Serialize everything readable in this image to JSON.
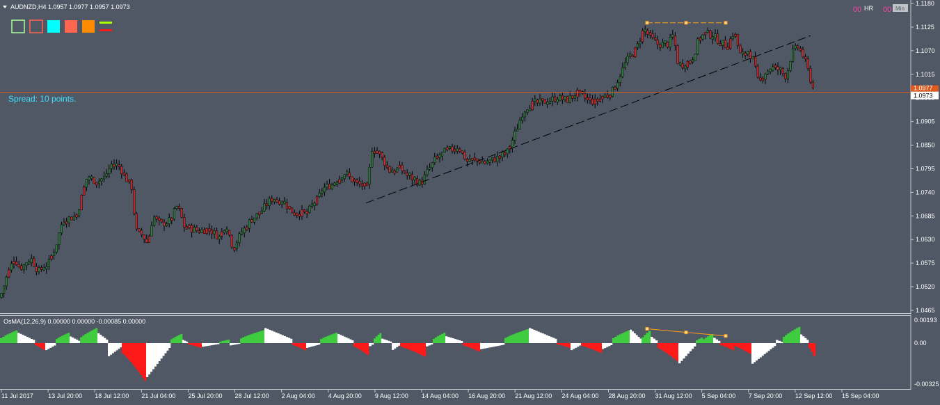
{
  "symbol_line": "AUDNZD,H4  1.0957 1.0977 1.0957 1.0973",
  "spread_text": "Spread: 10 points.",
  "hr_label": "HR",
  "hr_counter": "00",
  "min_label": "Min",
  "min_counter": "00",
  "osma_label": "OsMA(12,26,9) 0.00000 0.00000 -0.00085 0.00000",
  "current_price_label": "1.0973",
  "current_price_label_upper": "1.0977",
  "colors": {
    "background": "#4f5864",
    "bull_candle": "#2f7d3a",
    "bear_candle": "#cc2c2c",
    "grid_axis": "#c8ccd0",
    "price_line": "#e05a1e",
    "osma_up_green": "#3fcc3f",
    "osma_down_red": "#ff1a1a",
    "osma_white": "#ffffff",
    "spread_text": "#40e0ff",
    "divergence_line": "#ff9f1a",
    "trend_line": "#000000"
  },
  "toolbar_swatches": [
    {
      "name": "green-outline-box",
      "color": "#aaff99",
      "style": "outline"
    },
    {
      "name": "red-outline-box",
      "color": "#ff6650",
      "style": "outline"
    },
    {
      "name": "cyan-box",
      "color": "#00ffff",
      "style": "filled"
    },
    {
      "name": "salmon-box",
      "color": "#ff6650",
      "style": "filled"
    },
    {
      "name": "orange-box",
      "color": "#ff8c00",
      "style": "filled"
    },
    {
      "name": "lines-icon",
      "color": "#aaff00",
      "style": "lines"
    }
  ],
  "chart_data": [
    {
      "type": "candlestick",
      "title": "AUDNZD,H4",
      "ylim": [
        1.0465,
        1.118
      ],
      "y_ticks": [
        "1.1180",
        "1.1125",
        "1.1070",
        "1.1015",
        "1.0960",
        "1.0905",
        "1.0850",
        "1.0795",
        "1.0740",
        "1.0685",
        "1.0630",
        "1.0575",
        "1.0520",
        "1.0465"
      ],
      "x_ticks": [
        "11 Jul 2017",
        "13 Jul 20:00",
        "18 Jul 12:00",
        "21 Jul 04:00",
        "25 Jul 20:00",
        "28 Jul 12:00",
        "2 Aug 04:00",
        "4 Aug 20:00",
        "9 Aug 12:00",
        "14 Aug 04:00",
        "16 Aug 20:00",
        "21 Aug 12:00",
        "24 Aug 04:00",
        "28 Aug 20:00",
        "31 Aug 12:00",
        "5 Sep 04:00",
        "7 Sep 20:00",
        "12 Sep 12:00",
        "15 Sep 04:00"
      ],
      "current_price": 1.0973,
      "close_path": [
        [
          0,
          1.0495
        ],
        [
          10,
          1.0545
        ],
        [
          20,
          1.0585
        ],
        [
          30,
          1.0565
        ],
        [
          45,
          1.0585
        ],
        [
          55,
          1.0555
        ],
        [
          70,
          1.0575
        ],
        [
          80,
          1.0615
        ],
        [
          90,
          1.0675
        ],
        [
          110,
          1.0685
        ],
        [
          125,
          1.0775
        ],
        [
          140,
          1.0765
        ],
        [
          150,
          1.0775
        ],
        [
          160,
          1.0805
        ],
        [
          172,
          1.08
        ],
        [
          180,
          1.0775
        ],
        [
          190,
          1.075
        ],
        [
          195,
          1.065
        ],
        [
          205,
          1.064
        ],
        [
          212,
          1.062
        ],
        [
          220,
          1.0685
        ],
        [
          232,
          1.0665
        ],
        [
          245,
          1.0675
        ],
        [
          255,
          1.071
        ],
        [
          265,
          1.066
        ],
        [
          285,
          1.065
        ],
        [
          300,
          1.0655
        ],
        [
          315,
          1.0635
        ],
        [
          325,
          1.0665
        ],
        [
          335,
          1.061
        ],
        [
          345,
          1.064
        ],
        [
          360,
          1.0675
        ],
        [
          375,
          1.0695
        ],
        [
          390,
          1.0725
        ],
        [
          405,
          1.072
        ],
        [
          420,
          1.0695
        ],
        [
          440,
          1.069
        ],
        [
          455,
          1.072
        ],
        [
          465,
          1.075
        ],
        [
          480,
          1.076
        ],
        [
          495,
          1.0785
        ],
        [
          505,
          1.077
        ],
        [
          515,
          1.076
        ],
        [
          528,
          1.075
        ],
        [
          535,
          1.0845
        ],
        [
          545,
          1.083
        ],
        [
          560,
          1.079
        ],
        [
          575,
          1.0795
        ],
        [
          590,
          1.0775
        ],
        [
          605,
          1.076
        ],
        [
          615,
          1.079
        ],
        [
          625,
          1.0815
        ],
        [
          640,
          1.0835
        ],
        [
          660,
          1.0845
        ],
        [
          670,
          1.0815
        ],
        [
          685,
          1.0815
        ],
        [
          700,
          1.081
        ],
        [
          715,
          1.082
        ],
        [
          730,
          1.0835
        ],
        [
          742,
          1.0885
        ],
        [
          752,
          1.093
        ],
        [
          765,
          1.0945
        ],
        [
          780,
          1.095
        ],
        [
          800,
          1.096
        ],
        [
          815,
          1.0955
        ],
        [
          830,
          1.097
        ],
        [
          845,
          1.0955
        ],
        [
          855,
          1.095
        ],
        [
          870,
          1.0965
        ],
        [
          880,
          1.0975
        ],
        [
          890,
          1.101
        ],
        [
          900,
          1.1045
        ],
        [
          915,
          1.1075
        ],
        [
          925,
          1.112
        ],
        [
          935,
          1.11
        ],
        [
          945,
          1.1085
        ],
        [
          960,
          1.1085
        ],
        [
          968,
          1.1105
        ],
        [
          975,
          1.1035
        ],
        [
          985,
          1.104
        ],
        [
          995,
          1.105
        ],
        [
          1005,
          1.11
        ],
        [
          1015,
          1.111
        ],
        [
          1025,
          1.1105
        ],
        [
          1035,
          1.109
        ],
        [
          1045,
          1.108
        ],
        [
          1055,
          1.1115
        ],
        [
          1065,
          1.1055
        ],
        [
          1075,
          1.107
        ],
        [
          1082,
          1.105
        ],
        [
          1090,
          1.0995
        ],
        [
          1100,
          1.102
        ],
        [
          1110,
          1.103
        ],
        [
          1120,
          1.1025
        ],
        [
          1130,
          1.101
        ],
        [
          1138,
          1.1065
        ],
        [
          1148,
          1.108
        ],
        [
          1155,
          1.1055
        ],
        [
          1162,
          1.102
        ],
        [
          1170,
          1.0973
        ]
      ],
      "bear_segments": [
        [
          180,
          215
        ],
        [
          260,
          275
        ],
        [
          430,
          445
        ],
        [
          505,
          530
        ],
        [
          540,
          560
        ],
        [
          660,
          680
        ],
        [
          840,
          860
        ],
        [
          930,
          945
        ],
        [
          970,
          990
        ],
        [
          1050,
          1060
        ],
        [
          1080,
          1095
        ],
        [
          1150,
          1172
        ]
      ]
    },
    {
      "type": "histogram",
      "title": "OsMA(12,26,9)",
      "ylim": [
        -0.00325,
        0.00193
      ],
      "y_ticks": [
        "0.00193",
        "0.00",
        "-0.00325"
      ],
      "segments": [
        {
          "x0": 0,
          "x1": 25,
          "peak": 0.0011,
          "color": "green"
        },
        {
          "x0": 25,
          "x1": 50,
          "peak": 0.0009,
          "color": "white"
        },
        {
          "x0": 50,
          "x1": 65,
          "peak": -0.0006,
          "color": "red"
        },
        {
          "x0": 65,
          "x1": 80,
          "peak": -0.0006,
          "color": "white"
        },
        {
          "x0": 80,
          "x1": 100,
          "peak": 0.0009,
          "color": "green"
        },
        {
          "x0": 100,
          "x1": 115,
          "peak": 0.0006,
          "color": "white"
        },
        {
          "x0": 115,
          "x1": 140,
          "peak": 0.0013,
          "color": "green"
        },
        {
          "x0": 140,
          "x1": 155,
          "peak": 0.0009,
          "color": "white"
        },
        {
          "x0": 155,
          "x1": 175,
          "peak": -0.0011,
          "color": "white"
        },
        {
          "x0": 175,
          "x1": 210,
          "peak": -0.0031,
          "color": "red"
        },
        {
          "x0": 210,
          "x1": 245,
          "peak": -0.0028,
          "color": "white"
        },
        {
          "x0": 245,
          "x1": 262,
          "peak": 0.0008,
          "color": "green"
        },
        {
          "x0": 262,
          "x1": 270,
          "peak": 0.0003,
          "color": "white"
        },
        {
          "x0": 270,
          "x1": 290,
          "peak": -0.0004,
          "color": "red"
        },
        {
          "x0": 290,
          "x1": 315,
          "peak": -0.0003,
          "color": "white"
        },
        {
          "x0": 315,
          "x1": 330,
          "peak": 0.0003,
          "color": "green"
        },
        {
          "x0": 330,
          "x1": 345,
          "peak": -0.0002,
          "color": "white"
        },
        {
          "x0": 345,
          "x1": 380,
          "peak": 0.0011,
          "color": "green"
        },
        {
          "x0": 380,
          "x1": 420,
          "peak": 0.0013,
          "color": "white"
        },
        {
          "x0": 420,
          "x1": 440,
          "peak": -0.0006,
          "color": "red"
        },
        {
          "x0": 440,
          "x1": 460,
          "peak": -0.0004,
          "color": "white"
        },
        {
          "x0": 460,
          "x1": 485,
          "peak": 0.0009,
          "color": "green"
        },
        {
          "x0": 485,
          "x1": 508,
          "peak": 0.0008,
          "color": "white"
        },
        {
          "x0": 508,
          "x1": 530,
          "peak": -0.001,
          "color": "red"
        },
        {
          "x0": 530,
          "x1": 537,
          "peak": -0.0003,
          "color": "white"
        },
        {
          "x0": 537,
          "x1": 548,
          "peak": 0.0009,
          "color": "green"
        },
        {
          "x0": 548,
          "x1": 563,
          "peak": 0.0004,
          "color": "white"
        },
        {
          "x0": 563,
          "x1": 575,
          "peak": -0.0006,
          "color": "white"
        },
        {
          "x0": 575,
          "x1": 612,
          "peak": -0.0011,
          "color": "red"
        },
        {
          "x0": 612,
          "x1": 622,
          "peak": -0.0003,
          "color": "white"
        },
        {
          "x0": 622,
          "x1": 640,
          "peak": 0.0009,
          "color": "green"
        },
        {
          "x0": 640,
          "x1": 665,
          "peak": 0.0006,
          "color": "white"
        },
        {
          "x0": 665,
          "x1": 690,
          "peak": -0.0007,
          "color": "red"
        },
        {
          "x0": 690,
          "x1": 725,
          "peak": -0.0005,
          "color": "white"
        },
        {
          "x0": 725,
          "x1": 760,
          "peak": 0.0012,
          "color": "green"
        },
        {
          "x0": 760,
          "x1": 800,
          "peak": 0.0013,
          "color": "white"
        },
        {
          "x0": 800,
          "x1": 820,
          "peak": -0.0004,
          "color": "red"
        },
        {
          "x0": 820,
          "x1": 835,
          "peak": -0.0006,
          "color": "white"
        },
        {
          "x0": 835,
          "x1": 865,
          "peak": -0.0008,
          "color": "red"
        },
        {
          "x0": 865,
          "x1": 880,
          "peak": -0.0005,
          "color": "white"
        },
        {
          "x0": 880,
          "x1": 905,
          "peak": 0.0011,
          "color": "green"
        },
        {
          "x0": 905,
          "x1": 922,
          "peak": 0.0012,
          "color": "white"
        },
        {
          "x0": 922,
          "x1": 935,
          "peak": 0.0011,
          "color": "green"
        },
        {
          "x0": 935,
          "x1": 945,
          "peak": 0.0006,
          "color": "white"
        },
        {
          "x0": 945,
          "x1": 975,
          "peak": -0.0015,
          "color": "red"
        },
        {
          "x0": 975,
          "x1": 1000,
          "peak": -0.0017,
          "color": "white"
        },
        {
          "x0": 1000,
          "x1": 1010,
          "peak": 0.0005,
          "color": "green"
        },
        {
          "x0": 1010,
          "x1": 1025,
          "peak": 0.0008,
          "color": "green"
        },
        {
          "x0": 1025,
          "x1": 1035,
          "peak": 0.0005,
          "color": "white"
        },
        {
          "x0": 1035,
          "x1": 1055,
          "peak": -0.0006,
          "color": "red"
        },
        {
          "x0": 1055,
          "x1": 1080,
          "peak": -0.0009,
          "color": "red"
        },
        {
          "x0": 1080,
          "x1": 1115,
          "peak": -0.0017,
          "color": "white"
        },
        {
          "x0": 1115,
          "x1": 1125,
          "peak": 0.0003,
          "color": "white"
        },
        {
          "x0": 1125,
          "x1": 1150,
          "peak": 0.0014,
          "color": "green"
        },
        {
          "x0": 1150,
          "x1": 1162,
          "peak": 0.0008,
          "color": "white"
        },
        {
          "x0": 1162,
          "x1": 1172,
          "peak": -0.0012,
          "color": "red"
        }
      ]
    }
  ],
  "drawings": {
    "trend_line": {
      "from": [
        526,
        1.0715
      ],
      "to": [
        1165,
        1.1105
      ]
    },
    "price_divergence": [
      [
        930,
        1.1135
      ],
      [
        986,
        1.1135
      ],
      [
        1043,
        1.1135
      ]
    ],
    "osma_divergence": [
      [
        930,
        0.0012
      ],
      [
        986,
        0.0009
      ],
      [
        1043,
        0.0006
      ]
    ]
  }
}
